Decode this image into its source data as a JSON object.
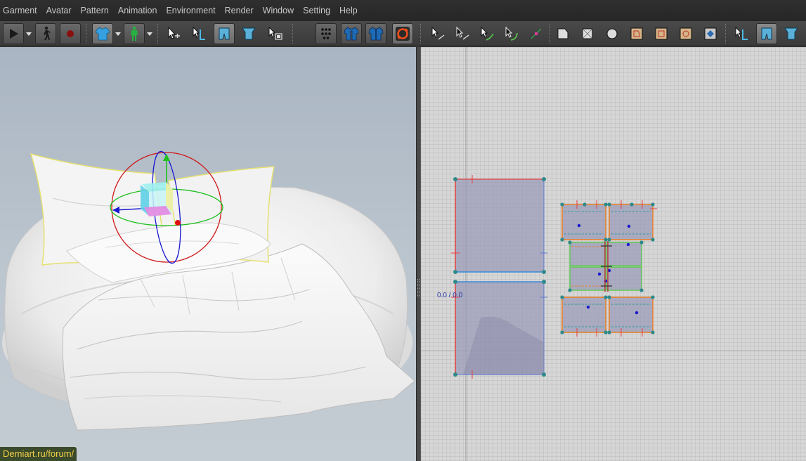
{
  "menu": [
    "Garment",
    "Avatar",
    "Pattern",
    "Animation",
    "Environment",
    "Render",
    "Window",
    "Setting",
    "Help"
  ],
  "toolbar": {
    "left": [
      {
        "name": "play-icon"
      },
      {
        "name": "dropdown-arrow-icon"
      },
      {
        "name": "walk-avatar-icon"
      },
      {
        "name": "record-icon"
      },
      {
        "name": "garment-shirt-icon"
      },
      {
        "name": "dropdown-arrow-icon"
      },
      {
        "name": "avatar-figure-icon"
      },
      {
        "name": "dropdown-arrow-icon"
      },
      {
        "name": "select-move-icon"
      },
      {
        "name": "transform-pattern-icon"
      },
      {
        "name": "fold-pattern-icon"
      },
      {
        "name": "unfold-pattern-icon"
      },
      {
        "name": "select-mesh-icon"
      },
      {
        "name": "pin-tool-icon"
      },
      {
        "name": "tack-icon"
      },
      {
        "name": "fitting-suit-icon"
      },
      {
        "name": "simulation-toggle-icon"
      }
    ],
    "right": [
      {
        "name": "select-point-icon"
      },
      {
        "name": "edit-point-icon"
      },
      {
        "name": "curve-point-icon"
      },
      {
        "name": "edit-curvature-icon"
      },
      {
        "name": "add-point-icon"
      },
      {
        "name": "polygon-icon"
      },
      {
        "name": "rectangle-icon"
      },
      {
        "name": "circle-icon"
      },
      {
        "name": "internal-polygon-icon"
      },
      {
        "name": "internal-rectangle-icon"
      },
      {
        "name": "internal-circle-icon"
      },
      {
        "name": "dart-icon"
      },
      {
        "name": "transform-icon"
      },
      {
        "name": "fold-icon"
      },
      {
        "name": "unfold-icon"
      }
    ]
  },
  "viewport2d": {
    "coord_label": "0.0 / 0.0"
  },
  "watermark": "Demiart.ru/forum/",
  "colors": {
    "menu_bg": "#262626",
    "toolbar_bg": "#444444",
    "viewport3d_bg": "#b4bfca",
    "viewport2d_bg": "#d6d6d6",
    "pattern_fill": "#9b9bb8",
    "selection_yellow": "#e5e070",
    "gizmo_red": "#d01818",
    "gizmo_green": "#1cc01c",
    "gizmo_blue": "#1818d0",
    "pattern_outline_orange": "#e8812a",
    "point_teal": "#2f8a8a"
  }
}
